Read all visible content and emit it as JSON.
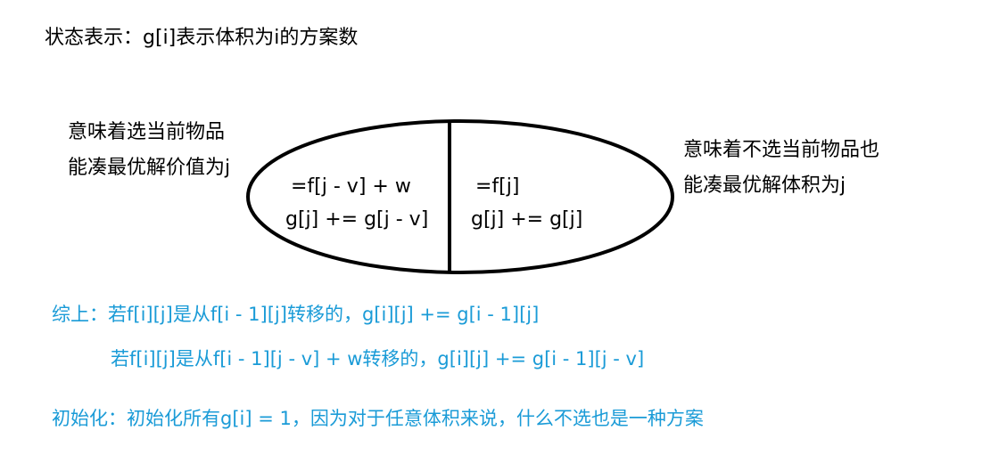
{
  "title": "状态表示：g[i]表示体积为i的方案数",
  "diagram": {
    "left_note": [
      "意味着选当前物品",
      "能凑最优解价值为j"
    ],
    "right_note": [
      "意味着不选当前物品也",
      "能凑最优解体积为j"
    ],
    "left_cell": [
      "=f[j - v] + w",
      "g[j] += g[j - v]"
    ],
    "right_cell": [
      "=f[j]",
      "g[j] += g[j]"
    ],
    "colors": {
      "text": "#000000",
      "highlight": "#1a9bd7"
    }
  },
  "summary": {
    "line1": "综上：若f[i][j]是从f[i - 1][j]转移的，g[i][j] += g[i - 1][j]",
    "line2": "若f[i][j]是从f[i - 1][j - v] + w转移的，g[i][j] += g[i - 1][j - v]"
  },
  "init": "初始化：初始化所有g[i] = 1，因为对于任意体积来说，什么不选也是一种方案"
}
